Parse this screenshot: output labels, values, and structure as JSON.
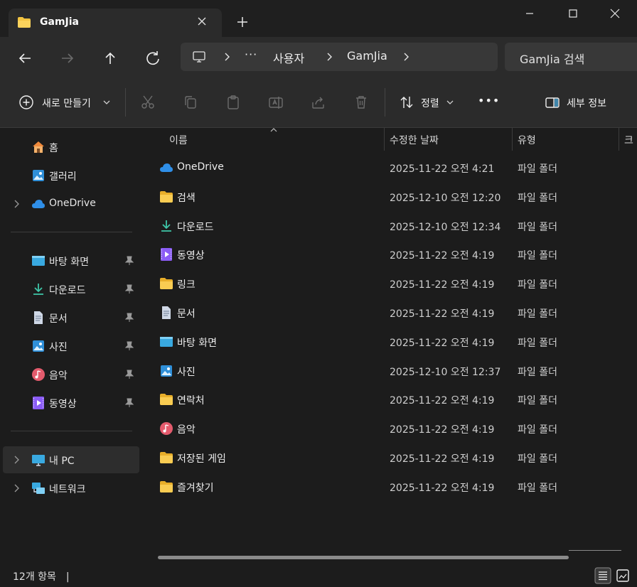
{
  "window": {
    "tab_title": "GamJia"
  },
  "address": {
    "ellipsis": "···",
    "crumbs": [
      "사용자",
      "GamJia"
    ]
  },
  "search": {
    "placeholder": "GamJia 검색"
  },
  "toolbar": {
    "new_label": "새로 만들기",
    "sort_label": "정렬",
    "details_label": "세부 정보",
    "more_label": "•••"
  },
  "sidebar": {
    "top_items": [
      {
        "label": "홈",
        "icon": "home-icon"
      },
      {
        "label": "갤러리",
        "icon": "gallery-icon"
      },
      {
        "label": "OneDrive",
        "icon": "cloud-icon"
      }
    ],
    "quick_access": [
      {
        "label": "바탕 화면",
        "icon": "desktop-icon"
      },
      {
        "label": "다운로드",
        "icon": "download-icon"
      },
      {
        "label": "문서",
        "icon": "document-icon"
      },
      {
        "label": "사진",
        "icon": "pictures-icon"
      },
      {
        "label": "음악",
        "icon": "music-icon"
      },
      {
        "label": "동영상",
        "icon": "video-icon"
      }
    ],
    "devices": [
      {
        "label": "내 PC",
        "icon": "pc-icon"
      },
      {
        "label": "네트워크",
        "icon": "network-icon"
      }
    ]
  },
  "columns": {
    "name": "이름",
    "date": "수정한 날짜",
    "type": "유형",
    "size": "크"
  },
  "files": [
    {
      "name": "OneDrive",
      "date": "2025-11-22 오전 4:21",
      "type": "파일 폴더",
      "icon": "cloud-icon"
    },
    {
      "name": "검색",
      "date": "2025-12-10 오전 12:20",
      "type": "파일 폴더",
      "icon": "folder-icon"
    },
    {
      "name": "다운로드",
      "date": "2025-12-10 오전 12:34",
      "type": "파일 폴더",
      "icon": "download-icon"
    },
    {
      "name": "동영상",
      "date": "2025-11-22 오전 4:19",
      "type": "파일 폴더",
      "icon": "video-icon"
    },
    {
      "name": "링크",
      "date": "2025-11-22 오전 4:19",
      "type": "파일 폴더",
      "icon": "folder-icon"
    },
    {
      "name": "문서",
      "date": "2025-11-22 오전 4:19",
      "type": "파일 폴더",
      "icon": "document-icon"
    },
    {
      "name": "바탕 화면",
      "date": "2025-11-22 오전 4:19",
      "type": "파일 폴더",
      "icon": "desktop-icon"
    },
    {
      "name": "사진",
      "date": "2025-12-10 오전 12:37",
      "type": "파일 폴더",
      "icon": "pictures-icon"
    },
    {
      "name": "연락처",
      "date": "2025-11-22 오전 4:19",
      "type": "파일 폴더",
      "icon": "folder-icon"
    },
    {
      "name": "음악",
      "date": "2025-11-22 오전 4:19",
      "type": "파일 폴더",
      "icon": "music-icon"
    },
    {
      "name": "저장된 게임",
      "date": "2025-11-22 오전 4:19",
      "type": "파일 폴더",
      "icon": "folder-icon"
    },
    {
      "name": "즐겨찾기",
      "date": "2025-11-22 오전 4:19",
      "type": "파일 폴더",
      "icon": "folder-icon"
    }
  ],
  "status": {
    "item_count": "12개 항목",
    "separator": "|",
    "active_view": "details-view"
  },
  "colors": {
    "folder": "#f4c542",
    "accent": "#4cc2ff",
    "download": "#3ec6a8",
    "video": "#8b5cf6",
    "music": "#e45b6d"
  }
}
